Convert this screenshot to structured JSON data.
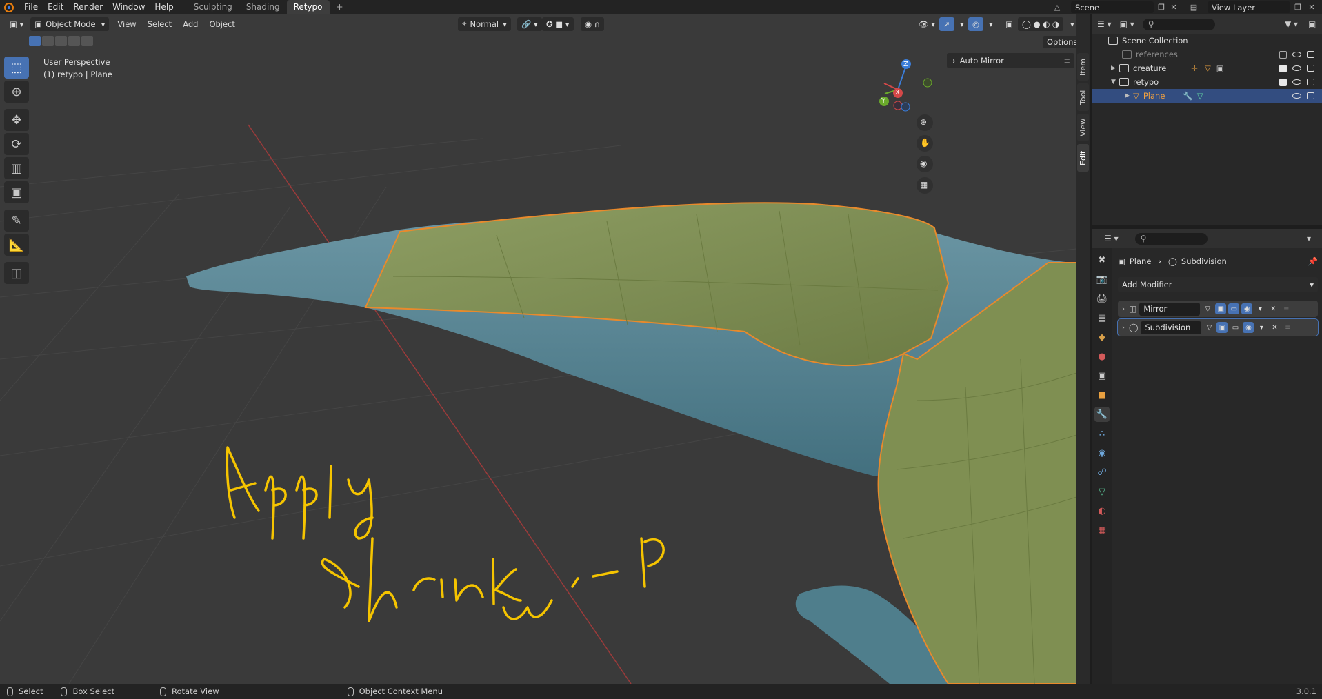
{
  "menubar": {
    "items": [
      "File",
      "Edit",
      "Render",
      "Window",
      "Help"
    ],
    "workspace_tabs": [
      "Sculpting",
      "Shading",
      "Retypo"
    ],
    "active_tab": "Retypo",
    "add_tab": "+",
    "scene_name": "Scene",
    "view_layer": "View Layer"
  },
  "viewport": {
    "mode": "Object Mode",
    "menus": [
      "View",
      "Select",
      "Add",
      "Object"
    ],
    "orientation": "Normal",
    "options_label": "Options",
    "perspective_label": "User Perspective",
    "object_label": "(1) retypo | Plane",
    "auto_mirror_label": "Auto Mirror",
    "annotation_line1": "Apply",
    "annotation_line2": "Shrink wrap",
    "gizmo_axes": [
      "X",
      "Y",
      "Z"
    ],
    "accent_color": "#4772b3",
    "annotation_color": "#f5c400"
  },
  "toolbar": {
    "tools": [
      "select-box-icon",
      "cursor-icon",
      "move-icon",
      "rotate-icon",
      "scale-icon",
      "transform-icon",
      "annotate-icon",
      "measure-icon",
      "add-cube-icon"
    ]
  },
  "npanel": {
    "tabs": [
      "Item",
      "Tool",
      "View",
      "Edit"
    ],
    "active": "Edit"
  },
  "outliner": {
    "search_placeholder": "",
    "scene_collection": "Scene Collection",
    "rows": [
      {
        "name": "references",
        "dimmed": true
      },
      {
        "name": "creature",
        "dimmed": false
      },
      {
        "name": "retypo",
        "dimmed": false
      },
      {
        "name": "Plane",
        "dimmed": false,
        "selected": true
      }
    ]
  },
  "properties": {
    "breadcrumb_object": "Plane",
    "breadcrumb_modifier": "Subdivision",
    "add_modifier": "Add Modifier",
    "modifiers": [
      {
        "name": "Mirror",
        "active": false
      },
      {
        "name": "Subdivision",
        "active": true
      }
    ]
  },
  "statusbar": {
    "items": [
      "Select",
      "Box Select",
      "Rotate View",
      "Object Context Menu"
    ],
    "version": "3.0.1"
  }
}
